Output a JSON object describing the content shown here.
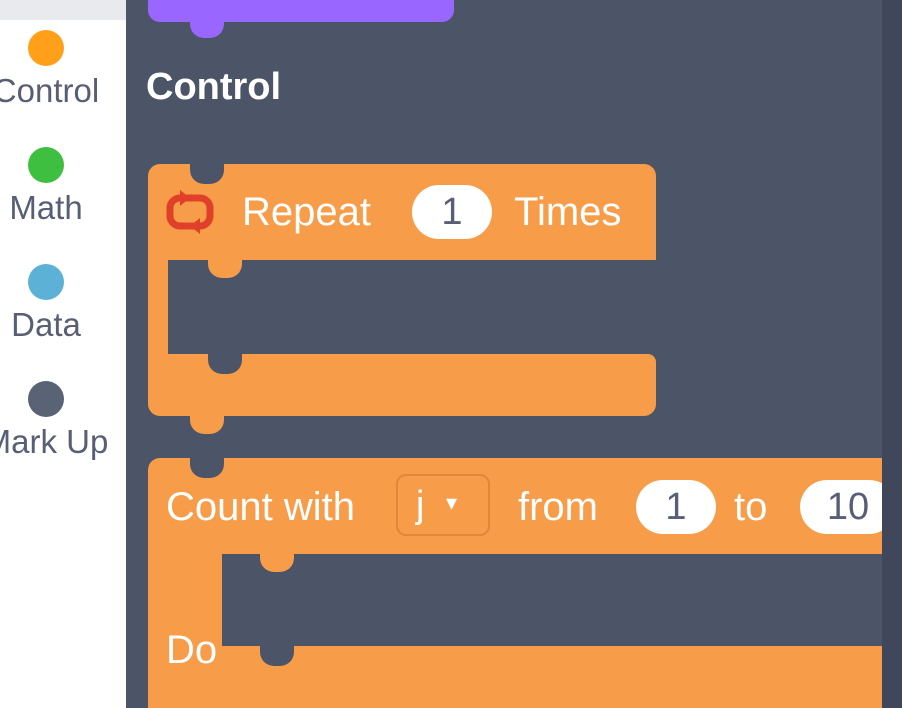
{
  "sidebar": {
    "items": [
      {
        "label": "Control",
        "color": "#ff9f1a"
      },
      {
        "label": "Math",
        "color": "#3fbf3f"
      },
      {
        "label": "Data",
        "color": "#5cb1d6"
      },
      {
        "label": "Mark Up",
        "color": "#5a6375"
      }
    ]
  },
  "workspace": {
    "section_title": "Control",
    "repeat_block": {
      "icon": "repeat-icon",
      "label_pre": "Repeat",
      "times_value": "1",
      "label_post": "Times"
    },
    "count_block": {
      "label": "Count with",
      "variable": "j",
      "from_label": "from",
      "from_value": "1",
      "to_label": "to",
      "to_value": "10",
      "do_label": "Do"
    }
  },
  "colors": {
    "control": "#f79c48",
    "looks": "#9966ff",
    "workspace_bg": "#4c5468"
  }
}
